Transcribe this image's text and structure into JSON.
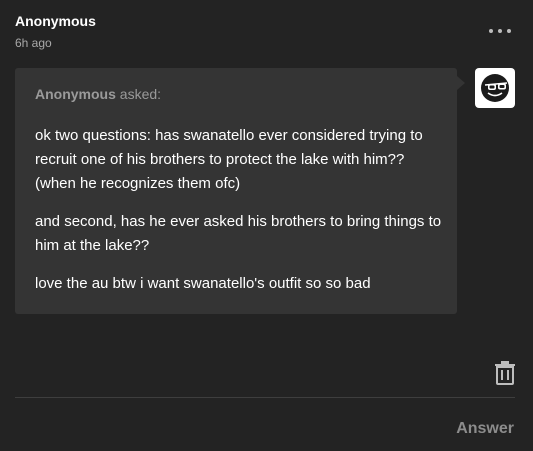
{
  "post": {
    "author": "Anonymous",
    "timestamp": "6h ago"
  },
  "ask": {
    "asker_name": "Anonymous",
    "asked_suffix": "asked:",
    "paragraphs": [
      "ok two questions: has swanatello ever considered trying to recruit one of his brothers to protect the lake with him?? (when he recognizes them ofc)",
      "and second, has he ever asked his brothers to bring things to him at the lake??",
      "love the au btw i want swanatello's outfit so so bad"
    ]
  },
  "icons": {
    "more": "more-options-icon",
    "avatar": "sunglasses-avatar-icon",
    "trash": "trash-icon"
  },
  "actions": {
    "answer_label": "Answer"
  },
  "colors": {
    "background": "#232323",
    "ask_bubble": "#343434",
    "text_primary": "#ffffff",
    "text_muted": "#9a9a9a"
  }
}
